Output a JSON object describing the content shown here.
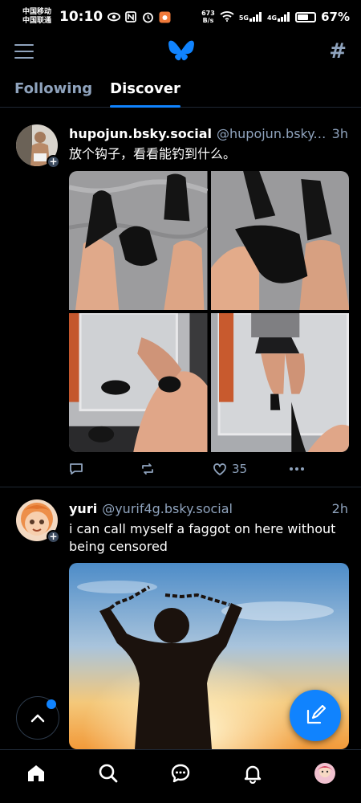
{
  "status_bar": {
    "carrier1": "中国移动",
    "carrier2": "中国联通",
    "time": "10:10",
    "net_speed_value": "673",
    "net_speed_unit": "B/s",
    "signal1": "5G",
    "signal2": "4G",
    "battery_pct_label": "67%",
    "battery_level": 0.67
  },
  "header": {
    "tabs": [
      {
        "label": "Following"
      },
      {
        "label": "Discover"
      }
    ]
  },
  "posts": [
    {
      "display_name": "hupojun.bsky.social",
      "handle": "@hupojun.bsky.so...",
      "time": "3h",
      "text": "放个钩子，看看能钓到什么。",
      "likes": "35",
      "image_count": 4
    },
    {
      "display_name": "yuri",
      "handle": "@yurif4g.bsky.social",
      "time": "2h",
      "text": "i can call myself a faggot on here without being censored"
    }
  ],
  "colors": {
    "accent": "#1083fe",
    "muted": "#8fa3bd",
    "background": "#000000",
    "divider": "#1e2733"
  },
  "icons": {
    "menu": "menu-icon",
    "logo": "butterfly-icon",
    "feeds": "hash-icon",
    "reply": "reply-icon",
    "repost": "repost-icon",
    "like": "heart-icon",
    "more": "more-icon",
    "scroll_top": "chevron-up-icon",
    "compose": "compose-icon",
    "nav": [
      "home-icon",
      "search-icon",
      "chat-icon",
      "bell-icon",
      "profile-avatar"
    ]
  }
}
